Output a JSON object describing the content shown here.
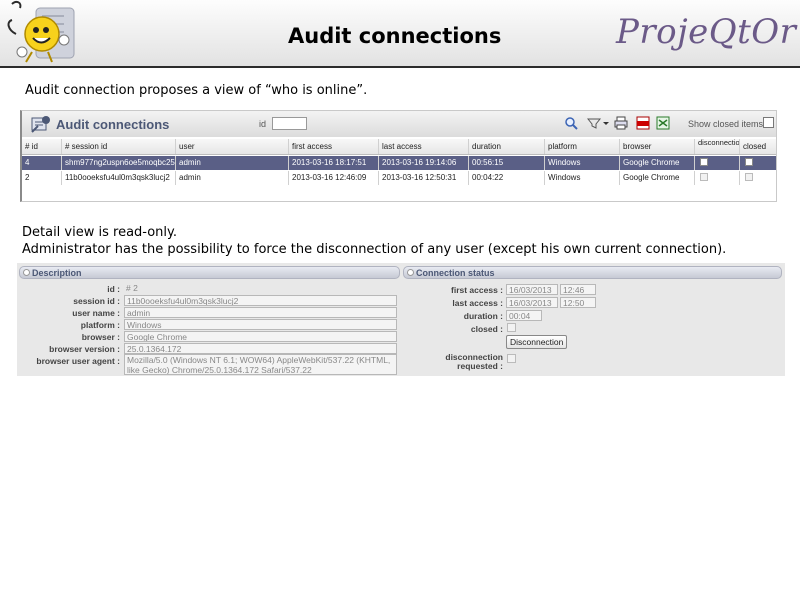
{
  "header": {
    "title": "Audit connections",
    "logo": "ProjeQtOr"
  },
  "intro": "Audit connection proposes a view of “who is online”.",
  "list": {
    "title": "Audit connections",
    "id_label": "id",
    "id_value": "",
    "show_closed_label": "Show closed items",
    "toolbar_icons": [
      "search-icon",
      "filter-icon",
      "print-icon",
      "pdf-icon",
      "csv-export-icon"
    ],
    "columns": [
      "# id",
      "# session id",
      "user",
      "first access",
      "last access",
      "duration",
      "platform",
      "browser",
      "disconnection requested",
      "closed"
    ],
    "rows": [
      {
        "id": "4",
        "session_id": "shm977ng2uspn6oe5moqbc25c2",
        "user": "admin",
        "first_access": "2013-03-16 18:17:51",
        "last_access": "2013-03-16 19:14:06",
        "duration": "00:56:15",
        "platform": "Windows",
        "browser": "Google Chrome"
      },
      {
        "id": "2",
        "session_id": "11b0ooeksfu4ul0m3qsk3lucj2",
        "user": "admin",
        "first_access": "2013-03-16 12:46:09",
        "last_access": "2013-03-16 12:50:31",
        "duration": "00:04:22",
        "platform": "Windows",
        "browser": "Google Chrome"
      }
    ]
  },
  "detail_note": {
    "line1": "Detail view is read-only.",
    "line2": "Administrator has the possibility to force the disconnection of any user (except his own current connection)."
  },
  "description": {
    "title": "Description",
    "labels": {
      "id": "id :",
      "session_id": "session id :",
      "user_name": "user name :",
      "platform": "platform :",
      "browser": "browser :",
      "browser_version": "browser version :",
      "user_agent": "browser user agent :"
    },
    "values": {
      "id": "# 2",
      "session_id": "11b0ooeksfu4ul0m3qsk3lucj2",
      "user_name": "admin",
      "platform": "Windows",
      "browser": "Google Chrome",
      "browser_version": "25.0.1364.172",
      "user_agent": "Mozilla/5.0 (Windows NT 6.1; WOW64) AppleWebKit/537.22 (KHTML, like Gecko) Chrome/25.0.1364.172 Safari/537.22"
    }
  },
  "status": {
    "title": "Connection status",
    "labels": {
      "first_access": "first access :",
      "last_access": "last access :",
      "duration": "duration :",
      "closed": "closed :",
      "disconnection_requested_1": "disconnection",
      "disconnection_requested_2": "requested :"
    },
    "values": {
      "first_access_date": "16/03/2013",
      "first_access_time": "12:46",
      "last_access_date": "16/03/2013",
      "last_access_time": "12:50",
      "duration": "00:04"
    },
    "disconnection_button": "Disconnection"
  }
}
